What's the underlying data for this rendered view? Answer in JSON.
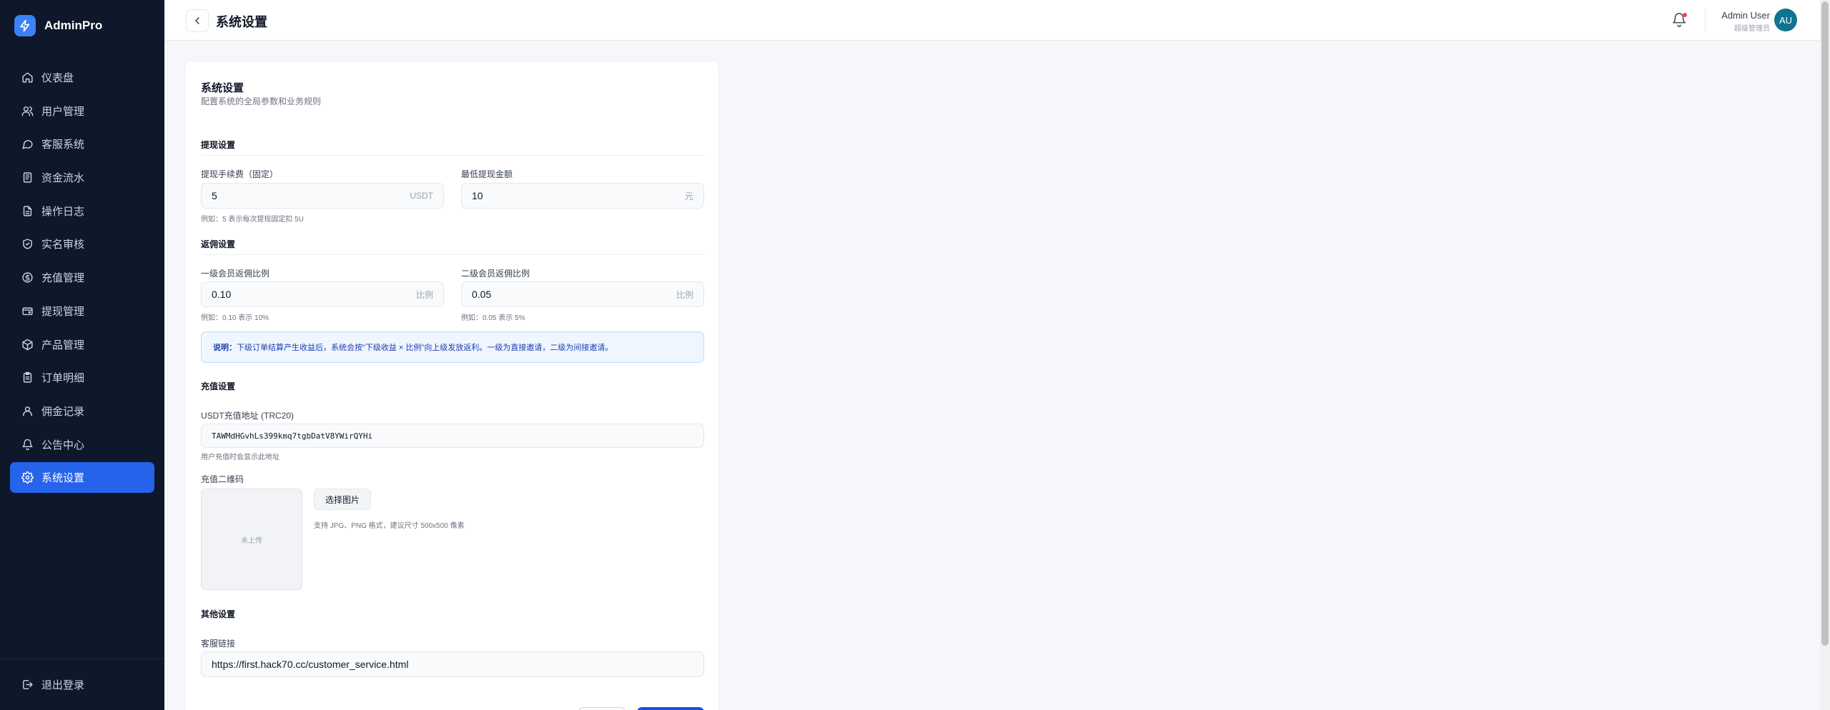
{
  "brand": {
    "name": "AdminPro"
  },
  "sidebar": {
    "items": [
      {
        "label": "仪表盘",
        "icon": "home-icon"
      },
      {
        "label": "用户管理",
        "icon": "users-icon"
      },
      {
        "label": "客服系统",
        "icon": "chat-icon"
      },
      {
        "label": "资金流水",
        "icon": "ledger-icon"
      },
      {
        "label": "操作日志",
        "icon": "file-icon"
      },
      {
        "label": "实名审核",
        "icon": "shield-check-icon"
      },
      {
        "label": "充值管理",
        "icon": "coin-icon"
      },
      {
        "label": "提现管理",
        "icon": "wallet-icon"
      },
      {
        "label": "产品管理",
        "icon": "box-icon"
      },
      {
        "label": "订单明细",
        "icon": "clipboard-icon"
      },
      {
        "label": "佣金记录",
        "icon": "users-icon"
      },
      {
        "label": "公告中心",
        "icon": "bell-icon"
      },
      {
        "label": "系统设置",
        "icon": "gear-icon",
        "active": true
      }
    ],
    "logout_label": "退出登录"
  },
  "header": {
    "title": "系统设置",
    "user_name": "Admin User",
    "user_role": "超级管理员",
    "avatar_initials": "AU"
  },
  "card": {
    "title": "系统设置",
    "subtitle": "配置系统的全局参数和业务规则"
  },
  "withdraw": {
    "section_title": "提现设置",
    "fee_label": "提现手续费（固定）",
    "fee_value": "5",
    "fee_suffix": "USDT",
    "fee_hint": "例如：5 表示每次提现固定扣 5U",
    "min_label": "最低提现金额",
    "min_value": "10",
    "min_suffix": "元"
  },
  "rebate": {
    "section_title": "返佣设置",
    "level1_label": "一级会员返佣比例",
    "level1_value": "0.10",
    "level1_suffix": "比例",
    "level1_hint": "例如：0.10 表示 10%",
    "level2_label": "二级会员返佣比例",
    "level2_value": "0.05",
    "level2_suffix": "比例",
    "level2_hint": "例如：0.05 表示 5%",
    "info_prefix": "说明：",
    "info_text": "下级订单结算产生收益后，系统会按\"下级收益 × 比例\"向上级发放返利。一级为直接邀请，二级为间接邀请。"
  },
  "recharge": {
    "section_title": "充值设置",
    "address_label": "USDT充值地址 (TRC20)",
    "address_value": "TAWMdHGvhLs399kmq7tgbDatV8YWirQYHi",
    "address_hint": "用户充值时会显示此地址",
    "qr_label": "充值二维码",
    "qr_empty": "未上传",
    "pick_button": "选择图片",
    "pick_hint": "支持 JPG、PNG 格式，建议尺寸 500x500 像素"
  },
  "other": {
    "section_title": "其他设置",
    "cs_label": "客服链接",
    "cs_value": "https://first.hack70.cc/customer_service.html"
  },
  "colors": {
    "sidebar_bg": "#0f172a",
    "accent": "#2563eb",
    "avatar": "#0e7490",
    "notification_dot": "#ef4444"
  }
}
